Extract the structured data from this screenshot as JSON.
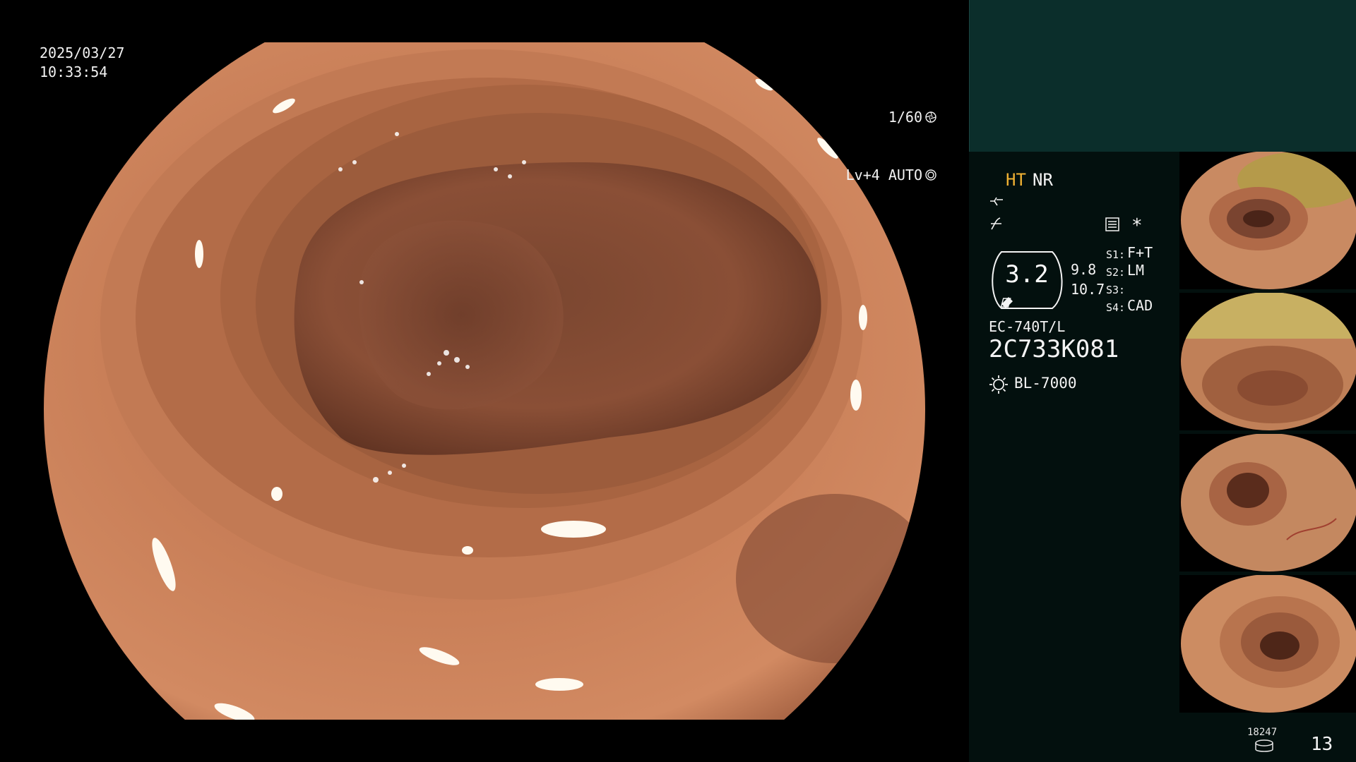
{
  "overlay": {
    "date": "2025/03/27",
    "time": "10:33:54",
    "shutter": "1/60",
    "level": "Lv+4 AUTO"
  },
  "panel": {
    "ht": "HT",
    "nr": "NR",
    "star": "*",
    "zoom": "3.2",
    "val_a": "9.8",
    "val_b": "10.7",
    "switches": [
      {
        "label": "S1:",
        "value": "F+T"
      },
      {
        "label": "S2:",
        "value": "LM"
      },
      {
        "label": "S3:",
        "value": ""
      },
      {
        "label": "S4:",
        "value": "CAD"
      }
    ],
    "scope_model": "EC-740T/L",
    "scope_serial": "2C733K081",
    "light_source": "BL-7000",
    "image_count_small": "18247",
    "image_count": "13"
  },
  "icons": {
    "shutter": "aperture-icon",
    "auto": "iris-icon",
    "structure": "structure-enhance-icon",
    "color": "color-enhance-icon",
    "select": "settings-list-icon",
    "lamp": "lamp-icon",
    "storage": "database-icon"
  },
  "thumbnails": [
    {
      "name": "capture-1"
    },
    {
      "name": "capture-2"
    },
    {
      "name": "capture-3"
    },
    {
      "name": "capture-4"
    }
  ]
}
